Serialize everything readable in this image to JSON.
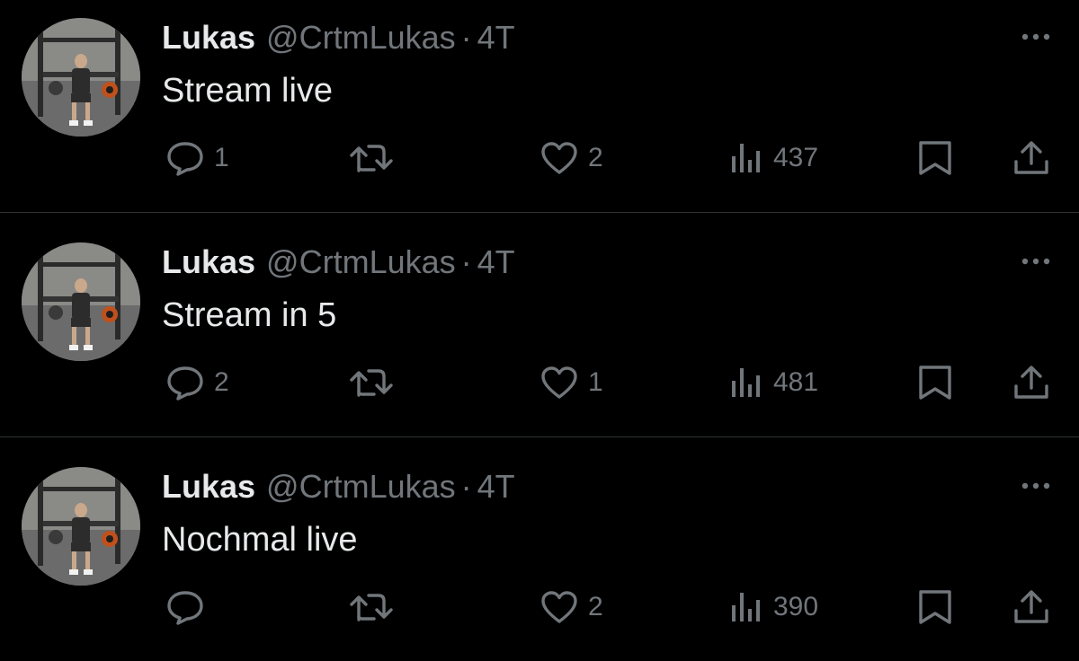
{
  "tweets": [
    {
      "name": "Lukas",
      "handle": "@CrtmLukas",
      "separator": "·",
      "time": "4T",
      "text": "Stream live",
      "replies": "1",
      "retweets": "",
      "likes": "2",
      "views": "437"
    },
    {
      "name": "Lukas",
      "handle": "@CrtmLukas",
      "separator": "·",
      "time": "4T",
      "text": "Stream in 5",
      "replies": "2",
      "retweets": "",
      "likes": "1",
      "views": "481"
    },
    {
      "name": "Lukas",
      "handle": "@CrtmLukas",
      "separator": "·",
      "time": "4T",
      "text": "Nochmal live",
      "replies": "",
      "retweets": "",
      "likes": "2",
      "views": "390"
    }
  ],
  "icons": {
    "reply": "reply-icon",
    "retweet": "retweet-icon",
    "like": "heart-icon",
    "views": "views-chart-icon",
    "bookmark": "bookmark-icon",
    "share": "share-icon",
    "more": "more-dots-icon"
  },
  "colors": {
    "background": "#000000",
    "text_primary": "#e7e9ea",
    "text_secondary": "#71767b",
    "divider": "#2f3336"
  }
}
